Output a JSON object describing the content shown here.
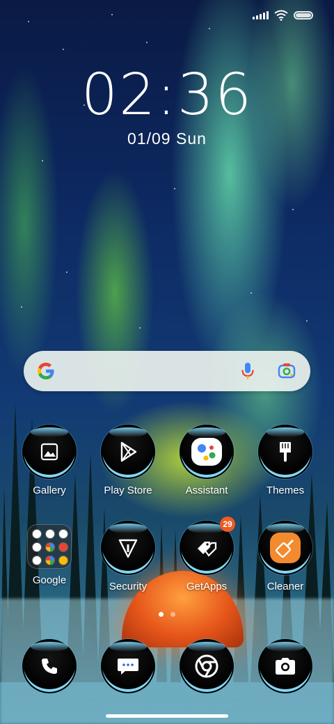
{
  "status_bar": {
    "icons": [
      "signal-icon",
      "wifi-icon",
      "battery-icon"
    ]
  },
  "lockclock": {
    "time": "02:36",
    "date": "01/09",
    "day": "Sun"
  },
  "search": {
    "icons": [
      "google-logo-icon",
      "microphone-icon",
      "google-lens-icon"
    ]
  },
  "apps": {
    "row1": [
      {
        "label": "Gallery",
        "icon": "gallery-icon"
      },
      {
        "label": "Play Store",
        "icon": "play-store-icon"
      },
      {
        "label": "Assistant",
        "icon": "assistant-icon"
      },
      {
        "label": "Themes",
        "icon": "paintbrush-icon"
      }
    ],
    "row2": [
      {
        "label": "Google",
        "icon": "folder-icon"
      },
      {
        "label": "Security",
        "icon": "shield-icon"
      },
      {
        "label": "GetApps",
        "icon": "getapps-icon",
        "badge": "29"
      },
      {
        "label": "Cleaner",
        "icon": "broom-icon"
      }
    ]
  },
  "page_indicator": {
    "count": 2,
    "active": 1
  },
  "dock": [
    {
      "icon": "phone-icon"
    },
    {
      "icon": "messages-icon"
    },
    {
      "icon": "chrome-icon"
    },
    {
      "icon": "camera-icon"
    }
  ],
  "colors": {
    "badge": "#f05a23",
    "icon_rim": "#8ce1ff",
    "search_bar": "#e8f0ec"
  }
}
